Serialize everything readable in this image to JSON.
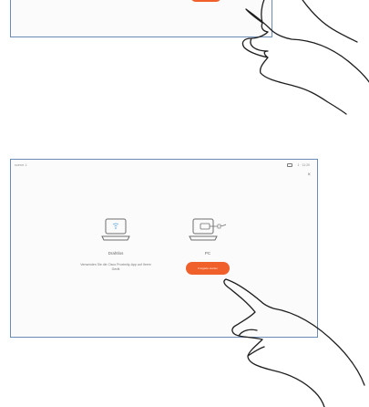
{
  "main_screen": {
    "status_left": "scene-1",
    "status_right": "1 · 11:20",
    "wireless_option": {
      "title": "Drahtlos",
      "description": "Verwenden Sie die Cisco Proximity-App auf Ihrem Gerät"
    },
    "pc_option": {
      "title": "PC",
      "button_label": "Freigabe starten"
    }
  },
  "colors": {
    "accent": "#f0602b",
    "screen_border": "#6a8bb3"
  }
}
